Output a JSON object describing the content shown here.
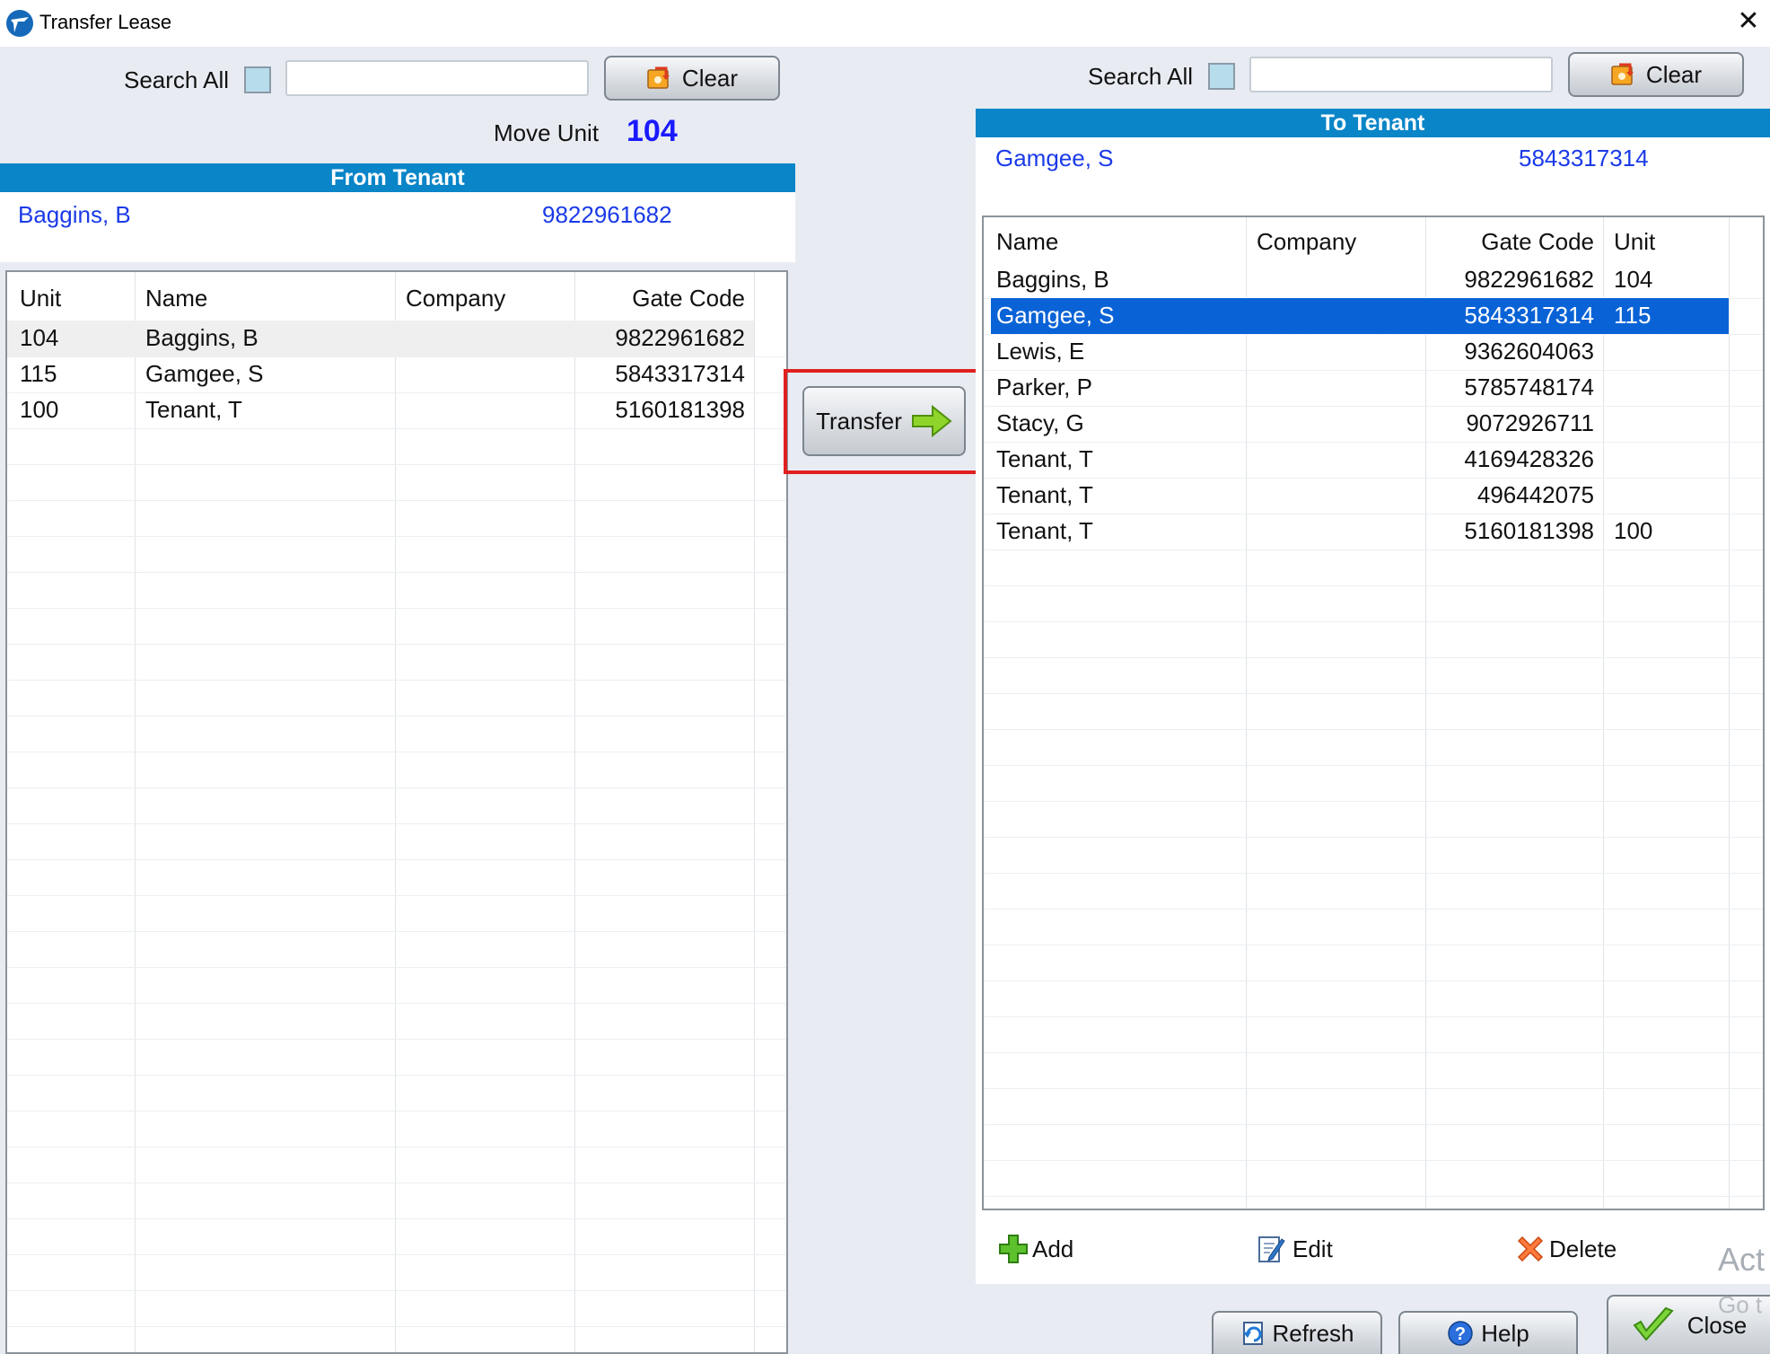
{
  "window": {
    "title": "Transfer Lease"
  },
  "left": {
    "search_label": "Search All",
    "search_value": "",
    "clear_label": "Clear",
    "move_unit_label": "Move Unit",
    "move_unit_value": "104",
    "header": "From Tenant",
    "tenant_name": "Baggins, B",
    "tenant_code": "9822961682",
    "columns": [
      "Unit",
      "Name",
      "Company",
      "Gate Code"
    ],
    "rows": [
      [
        "104",
        "Baggins, B",
        "",
        "9822961682"
      ],
      [
        "115",
        "Gamgee, S",
        "",
        "5843317314"
      ],
      [
        "100",
        "Tenant, T",
        "",
        "5160181398"
      ]
    ]
  },
  "transfer_label": "Transfer",
  "right": {
    "search_label": "Search All",
    "search_value": "",
    "clear_label": "Clear",
    "header": "To Tenant",
    "tenant_name": "Gamgee, S",
    "tenant_code": "5843317314",
    "columns": [
      "Name",
      "Company",
      "Gate Code",
      "Unit"
    ],
    "rows": [
      [
        "Baggins, B",
        "",
        "9822961682",
        "104"
      ],
      [
        "Gamgee, S",
        "",
        "5843317314",
        "115"
      ],
      [
        "Lewis, E",
        "",
        "9362604063",
        ""
      ],
      [
        "Parker, P",
        "",
        "5785748174",
        ""
      ],
      [
        "Stacy, G",
        "",
        "9072926711",
        ""
      ],
      [
        "Tenant, T",
        "",
        "4169428326",
        ""
      ],
      [
        "Tenant, T",
        "",
        "496442075",
        ""
      ],
      [
        "Tenant, T",
        "",
        "5160181398",
        "100"
      ]
    ],
    "add_label": "Add",
    "edit_label": "Edit",
    "delete_label": "Delete"
  },
  "footer": {
    "refresh_label": "Refresh",
    "help_label": "Help",
    "close_label": "Close"
  },
  "watermark": {
    "line1": "Act",
    "line2": "Go t"
  },
  "colors": {
    "header_bar": "#0a85c8",
    "selection": "#0a63d6",
    "link_text": "#1a3ae8",
    "accent_value": "#1a1aff"
  }
}
